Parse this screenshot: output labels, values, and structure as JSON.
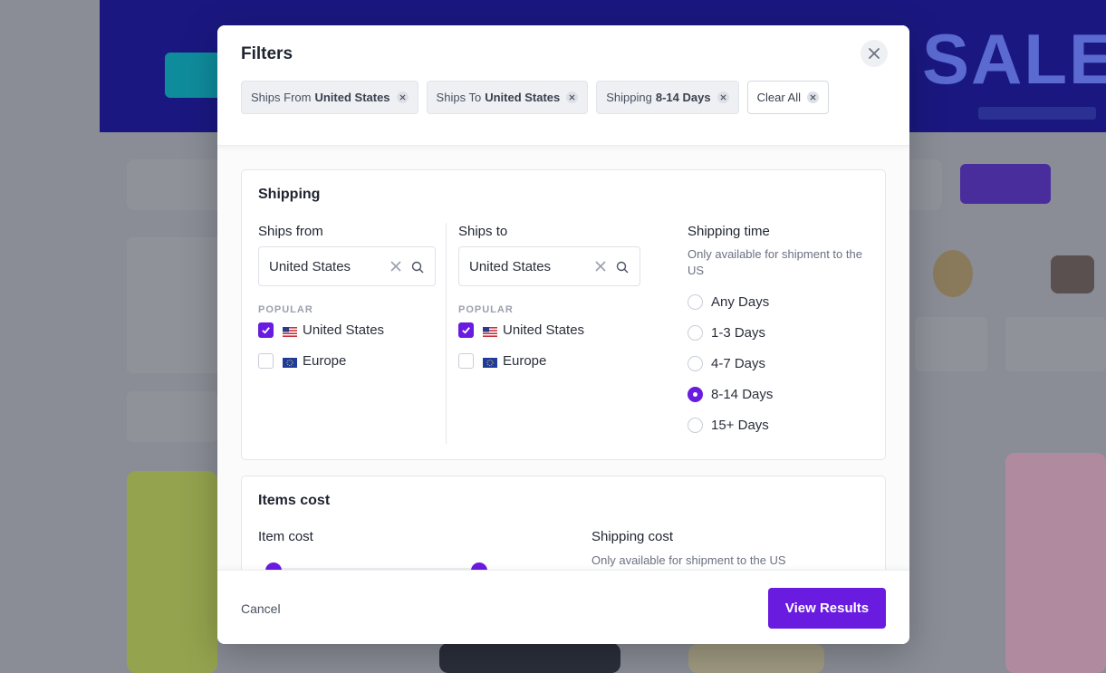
{
  "modal": {
    "title": "Filters",
    "chips": [
      {
        "prefix": "Ships From",
        "value": "United States"
      },
      {
        "prefix": "Ships To",
        "value": "United States"
      },
      {
        "prefix": "Shipping",
        "value": "8-14 Days"
      },
      {
        "label": "Clear All"
      }
    ]
  },
  "shipping": {
    "title": "Shipping",
    "ships_from": {
      "label": "Ships from",
      "value": "United States",
      "popular_label": "POPULAR",
      "options": [
        {
          "label": "United States",
          "checked": true,
          "flag": "us-flag-icon"
        },
        {
          "label": "Europe",
          "checked": false,
          "flag": "eu-flag-icon"
        }
      ]
    },
    "ships_to": {
      "label": "Ships to",
      "value": "United States",
      "popular_label": "POPULAR",
      "options": [
        {
          "label": "United States",
          "checked": true,
          "flag": "us-flag-icon"
        },
        {
          "label": "Europe",
          "checked": false,
          "flag": "eu-flag-icon"
        }
      ]
    },
    "shipping_time": {
      "label": "Shipping time",
      "hint": "Only available for shipment to the US",
      "options": [
        "Any Days",
        "1-3 Days",
        "4-7 Days",
        "8-14 Days",
        "15+ Days"
      ],
      "selected": "8-14 Days"
    }
  },
  "items_cost": {
    "title": "Items cost",
    "item_cost_label": "Item cost",
    "shipping_cost_label": "Shipping cost",
    "shipping_cost_hint": "Only available for shipment to the US"
  },
  "footer": {
    "cancel": "Cancel",
    "view_results": "View Results"
  },
  "colors": {
    "accent": "#6a1be0",
    "chip_bg": "#eef0f4",
    "backdrop": "#8a8d96"
  }
}
